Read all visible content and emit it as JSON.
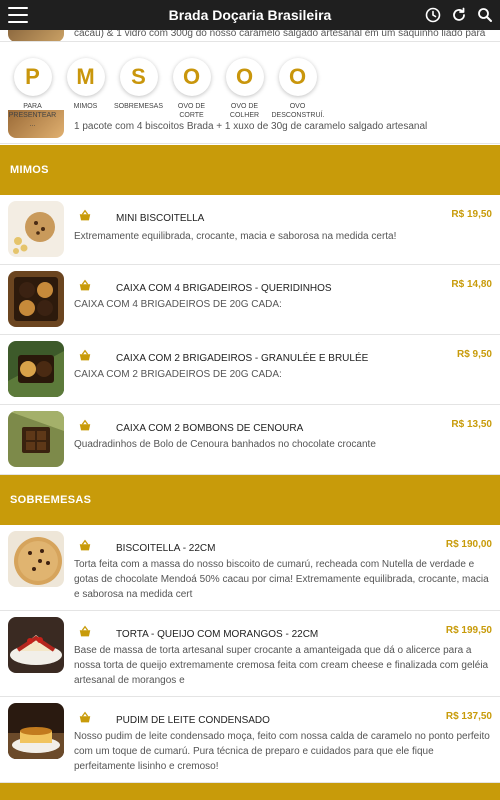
{
  "app": {
    "title": "Brada Doçaria Brasileira"
  },
  "partial_top_item": {
    "desc": "cacau) & 1 vidro com 300g do nosso caramelo salgado artesanal em um saquinho liado para"
  },
  "categories": [
    {
      "letter": "P",
      "label": "PARA PRESENTEAR ..."
    },
    {
      "letter": "M",
      "label": "MIMOS"
    },
    {
      "letter": "S",
      "label": "SOBREMESAS"
    },
    {
      "letter": "O",
      "label": "OVO DE CORTE"
    },
    {
      "letter": "O",
      "label": "OVO DE COLHER"
    },
    {
      "letter": "O",
      "label": "OVO DESCONSTRUÍ..."
    }
  ],
  "partial_item": {
    "desc": "1 pacote com 4 biscoitos Brada + 1 xuxo de 30g de caramelo salgado artesanal"
  },
  "sections": {
    "mimos": "MIMOS",
    "sobremesas": "SOBREMESAS"
  },
  "mimos_items": [
    {
      "name": "MINI BISCOITELLA",
      "price": "R$ 19,50",
      "desc": "Extremamente equilibrada, crocante, macia e saborosa na medida certa!"
    },
    {
      "name": "CAIXA COM 4 BRIGADEIROS - QUERIDINHOS",
      "price": "R$ 14,80",
      "desc": "CAIXA COM 4 BRIGADEIROS DE 20G CADA:"
    },
    {
      "name": "CAIXA COM 2 BRIGADEIROS - GRANULÉE E BRULÉE",
      "price": "R$ 9,50",
      "desc": "CAIXA COM 2 BRIGADEIROS DE 20G CADA:"
    },
    {
      "name": "CAIXA COM 2 BOMBONS DE CENOURA",
      "price": "R$ 13,50",
      "desc": "Quadradinhos de Bolo de Cenoura banhados no chocolate crocante"
    }
  ],
  "sobremesas_items": [
    {
      "name": "BISCOITELLA - 22CM",
      "price": "R$ 190,00",
      "desc": "Torta feita com a massa do nosso biscoito de cumarú, recheada com Nutella de verdade e gotas de chocolate Mendoá 50% cacau por cima! Extremamente equilibrada, crocante, macia e saborosa na medida cert"
    },
    {
      "name": "TORTA - QUEIJO COM MORANGOS - 22CM",
      "price": "R$ 199,50",
      "desc": "Base de massa de torta artesanal super crocante a amanteigada que dá o alicerce para a nossa torta de queijo extremamente cremosa feita com cream cheese e finalizada com geléia artesanal de morangos e"
    },
    {
      "name": "PUDIM DE LEITE CONDENSADO",
      "price": "R$ 137,50",
      "desc": "Nosso pudim de leite condensado moça, feito com nossa calda de caramelo no ponto perfeito com um toque de cumarú. Pura técnica de preparo e cuidados para que ele fique perfeitamente lisinho e cremoso!"
    }
  ],
  "colors": {
    "accent": "#c89b0a",
    "appbar": "#1f1f1f"
  },
  "icons": {
    "menu": "hamburger-menu-icon",
    "history": "clock-history-icon",
    "refresh": "refresh-icon",
    "search": "search-icon",
    "basket": "basket-icon"
  }
}
